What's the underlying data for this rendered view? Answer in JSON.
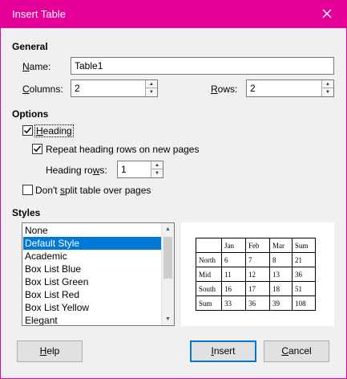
{
  "window": {
    "title": "Insert Table",
    "close_icon": "close-icon"
  },
  "general": {
    "heading": "General",
    "name_label": "Name:",
    "name_value": "Table1",
    "columns_label": "Columns:",
    "columns_value": "2",
    "rows_label": "Rows:",
    "rows_value": "2"
  },
  "options": {
    "heading": "Options",
    "heading_check_label": "Heading",
    "heading_checked": true,
    "repeat_label": "Repeat heading rows on new pages",
    "repeat_checked": true,
    "heading_rows_label": "Heading rows:",
    "heading_rows_value": "1",
    "dont_split_label": "Don't split table over pages",
    "dont_split_checked": false
  },
  "styles": {
    "heading": "Styles",
    "items": [
      "None",
      "Default Style",
      "Academic",
      "Box List Blue",
      "Box List Green",
      "Box List Red",
      "Box List Yellow",
      "Elegant"
    ],
    "selected_index": 1
  },
  "preview": {
    "header": [
      "",
      "Jan",
      "Feb",
      "Mar",
      "Sum"
    ],
    "rows": [
      [
        "North",
        "6",
        "7",
        "8",
        "21"
      ],
      [
        "Mid",
        "11",
        "12",
        "13",
        "36"
      ],
      [
        "South",
        "16",
        "17",
        "18",
        "51"
      ],
      [
        "Sum",
        "33",
        "36",
        "39",
        "108"
      ]
    ]
  },
  "buttons": {
    "help": "Help",
    "insert": "Insert",
    "cancel": "Cancel"
  },
  "colors": {
    "titlebar": "#e5009a",
    "selection": "#0078d7",
    "default_button_border": "#0078d7"
  }
}
